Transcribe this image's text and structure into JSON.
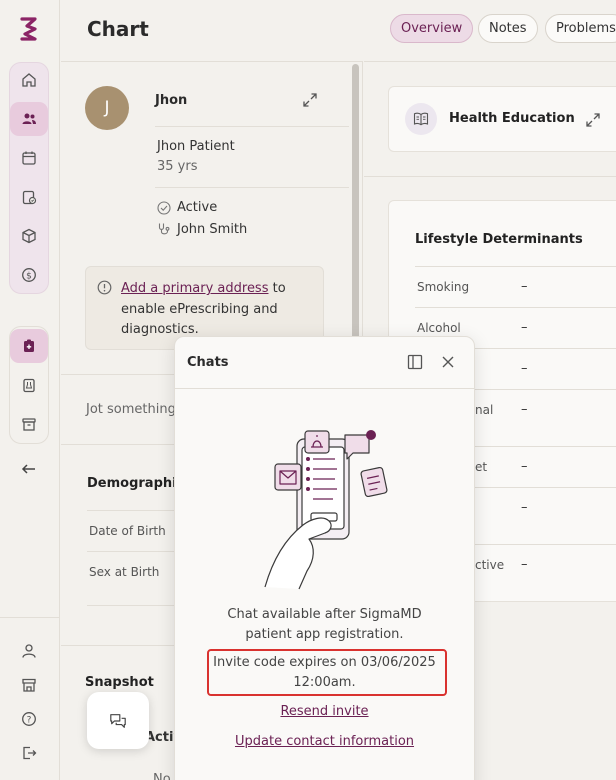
{
  "header": {
    "title": "Chart",
    "tabs": [
      {
        "label": "Overview",
        "active": true
      },
      {
        "label": "Notes",
        "active": false
      },
      {
        "label": "Problems",
        "active": false
      }
    ]
  },
  "patient": {
    "initial": "J",
    "name": "Jhon",
    "full_name": "Jhon Patient",
    "age": "35 yrs",
    "status": "Active",
    "provider": "John Smith"
  },
  "notice": {
    "link_text": "Add a primary address",
    "rest_text": " to enable ePrescribing and diagnostics."
  },
  "jot_placeholder": "Jot something",
  "demographics": {
    "title": "Demographics",
    "fields": [
      "Date of Birth",
      "Sex at Birth"
    ]
  },
  "snapshot": {
    "title": "Snapshot",
    "partial_item": "Activ",
    "partial_item_2": "No"
  },
  "health_education": {
    "title": "Health Education"
  },
  "lifestyle": {
    "title": "Lifestyle Determinants",
    "rows": [
      {
        "label": "Smoking",
        "value": "–"
      },
      {
        "label": "Alcohol",
        "value": "–"
      },
      {
        "label": "",
        "value": "–"
      },
      {
        "label": "nal",
        "value": "–"
      },
      {
        "label": "et",
        "value": "–"
      },
      {
        "label": "",
        "value": "–"
      },
      {
        "label": "ctive",
        "value": "–"
      }
    ]
  },
  "chat": {
    "title": "Chats",
    "message_line1": "Chat available after SigmaMD",
    "message_line2": "patient app registration.",
    "invite_line1": "Invite code expires on 03/06/2025",
    "invite_line2": "12:00am.",
    "resend": "Resend invite",
    "update": "Update contact information"
  },
  "colors": {
    "brand": "#6b2154",
    "highlight": "#d9322f"
  }
}
